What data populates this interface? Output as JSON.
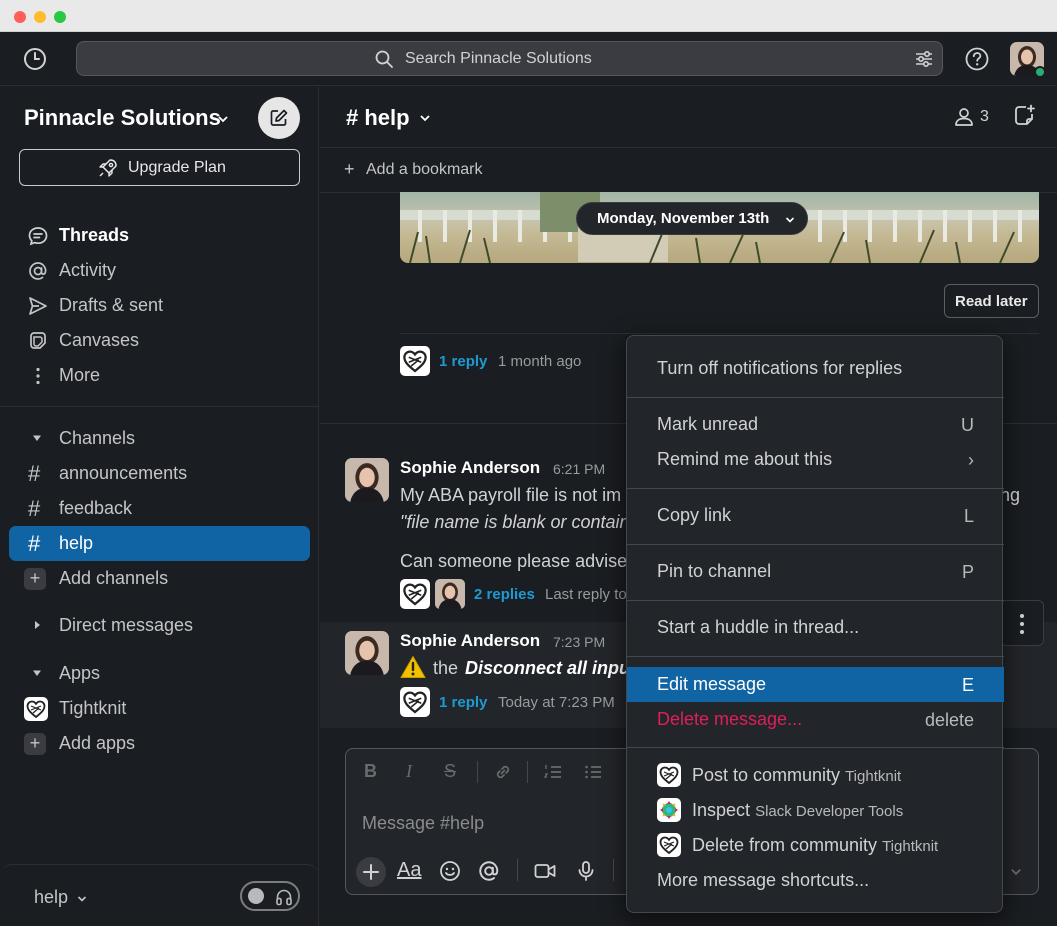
{
  "workspace": {
    "name": "Pinnacle Solutions",
    "upgrade_label": "Upgrade Plan"
  },
  "search": {
    "placeholder": "Search Pinnacle Solutions"
  },
  "sidebar": {
    "nav": [
      {
        "label": "Threads",
        "icon": "threads-icon",
        "bold": true
      },
      {
        "label": "Activity",
        "icon": "at-sign-icon"
      },
      {
        "label": "Drafts & sent",
        "icon": "send-icon"
      },
      {
        "label": "Canvases",
        "icon": "canvas-icon"
      },
      {
        "label": "More",
        "icon": "more-vertical-icon"
      }
    ],
    "channels_header": "Channels",
    "channels": [
      "announcements",
      "feedback",
      "help"
    ],
    "active_channel": "help",
    "add_channels": "Add channels",
    "dm_header": "Direct messages",
    "apps_header": "Apps",
    "apps": [
      "Tightknit"
    ],
    "add_apps": "Add apps",
    "footer_label": "help"
  },
  "channel": {
    "name": "# help",
    "member_count": "3",
    "add_bookmark": "Add a bookmark"
  },
  "feed": {
    "date_divider": "Monday, November 13th",
    "read_later": "Read later",
    "thread1": {
      "replies": "1 reply",
      "meta": "1 month ago"
    },
    "msg1": {
      "author": "Sophie Anderson",
      "time": "6:21 PM",
      "line1": "My ABA payroll file is not im",
      "line1_tail": "ng",
      "line2": "\"file name is blank or contains",
      "line3": "Can someone please advise",
      "replies": "2 replies",
      "meta": "Last reply to"
    },
    "msg2": {
      "author": "Sophie Anderson",
      "time": "7:23 PM",
      "text_pre": "the",
      "text_bold": "Disconnect all inputs",
      "replies": "1 reply",
      "meta": "Today at 7:23 PM"
    }
  },
  "composer": {
    "placeholder": "Message #help"
  },
  "context_menu": {
    "items": [
      {
        "label": "Turn off notifications for replies",
        "key": ""
      },
      {
        "label": "Mark unread",
        "key": "U"
      },
      {
        "label": "Remind me about this",
        "key": "›"
      },
      {
        "label": "Copy link",
        "key": "L"
      },
      {
        "label": "Pin to channel",
        "key": "P"
      },
      {
        "label": "Start a huddle in thread...",
        "key": ""
      },
      {
        "label": "Edit message",
        "key": "E"
      },
      {
        "label": "Delete message...",
        "key": "delete"
      }
    ],
    "apps": [
      {
        "label": "Post to community",
        "sub": "Tightknit"
      },
      {
        "label": "Inspect",
        "sub": "Slack Developer Tools"
      },
      {
        "label": "Delete from community",
        "sub": "Tightknit"
      }
    ],
    "more_shortcuts": "More message shortcuts..."
  },
  "colors": {
    "accent": "#1164a3",
    "link": "#1d9bd1",
    "danger": "#e01e5a",
    "online": "#2bac76"
  }
}
